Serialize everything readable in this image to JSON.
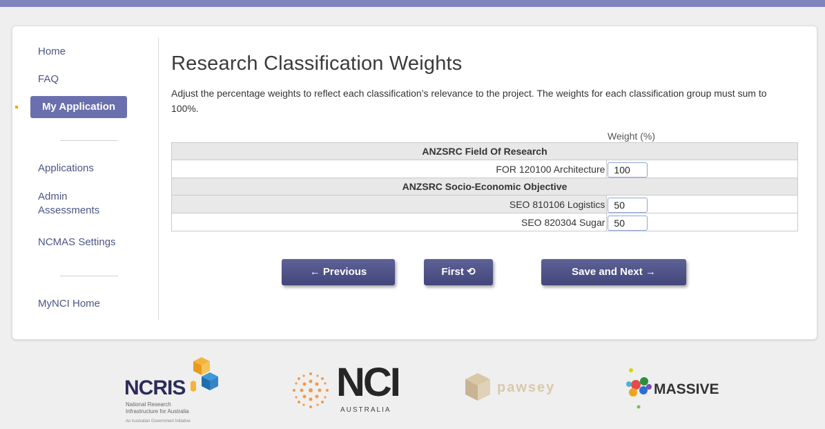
{
  "sidebar": {
    "items": [
      {
        "label": "Home"
      },
      {
        "label": "FAQ"
      },
      {
        "label": "My Application"
      },
      {
        "label": "Applications"
      },
      {
        "label": "Admin Assessments"
      },
      {
        "label": "NCMAS Settings"
      },
      {
        "label": "MyNCI Home"
      }
    ]
  },
  "main": {
    "title": "Research Classification Weights",
    "intro": "Adjust the percentage weights to reflect each classification’s relevance to the project. The weights for each classification group must sum to 100%.",
    "weight_header": "Weight (%)",
    "groups": [
      {
        "name": "ANZSRC Field Of Research",
        "items": [
          {
            "label": "FOR 120100 Architecture",
            "value": "100"
          }
        ]
      },
      {
        "name": "ANZSRC Socio-Economic Objective",
        "items": [
          {
            "label": "SEO 810106 Logistics",
            "value": "50"
          },
          {
            "label": "SEO 820304 Sugar",
            "value": "50"
          }
        ]
      }
    ]
  },
  "buttons": {
    "previous": "← Previous",
    "first": "First ⟲",
    "save_next": "Save and Next →"
  },
  "footer": {
    "ncris_title": "NCRIS",
    "ncris_sub1": "National Research",
    "ncris_sub2": "Infrastructure for Australia",
    "ncris_sub3": "An Australian Government Initiative",
    "nci_title": "NCI",
    "nci_sub": "AUSTRALIA",
    "pawsey": "pawsey",
    "massive": "MASSIVE"
  },
  "colors": {
    "accent": "#6a6fae",
    "top_bar": "#7d84be",
    "button": "#4a4e85"
  }
}
